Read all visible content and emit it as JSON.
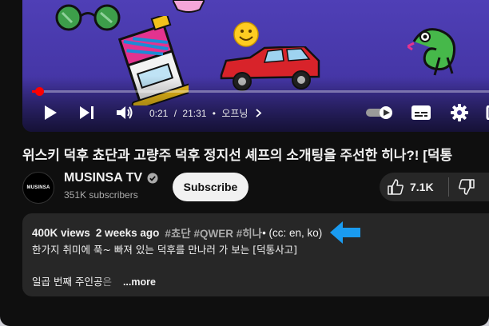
{
  "player": {
    "current_time": "0:21",
    "duration": "21:31",
    "separator": "/",
    "chapter_dot": "•",
    "chapter": "오프닝",
    "progress_fraction": 0.016
  },
  "video": {
    "title": "위스키 덕후 쵸단과 고량주 덕후 정지선 셰프의 소개팅을 주선한 히나?! [덕통"
  },
  "channel": {
    "avatar_text": "MUSINSA",
    "name": "MUSINSA TV",
    "subscribers": "351K subscribers",
    "subscribe_label": "Subscribe"
  },
  "actions": {
    "like_count": "7.1K"
  },
  "description": {
    "views": "400K views",
    "age": "2 weeks ago",
    "tags": "#쵸단 #QWER #히나",
    "captions": "• (cc: en, ko)",
    "line1": "한가지 취미에 푹~ 빠져 있는 덕후를 만나러 가 보는 [덕통사고]",
    "line2_text": "일곱 번째 주인공",
    "line2_faded": "은",
    "more_label": "...more"
  },
  "colors": {
    "background": "#0f0f0f",
    "player_purple": "#4f3fb6",
    "progress_red": "#ff0000",
    "card_gray": "#272727",
    "annotation_arrow": "#1a9bf0"
  }
}
